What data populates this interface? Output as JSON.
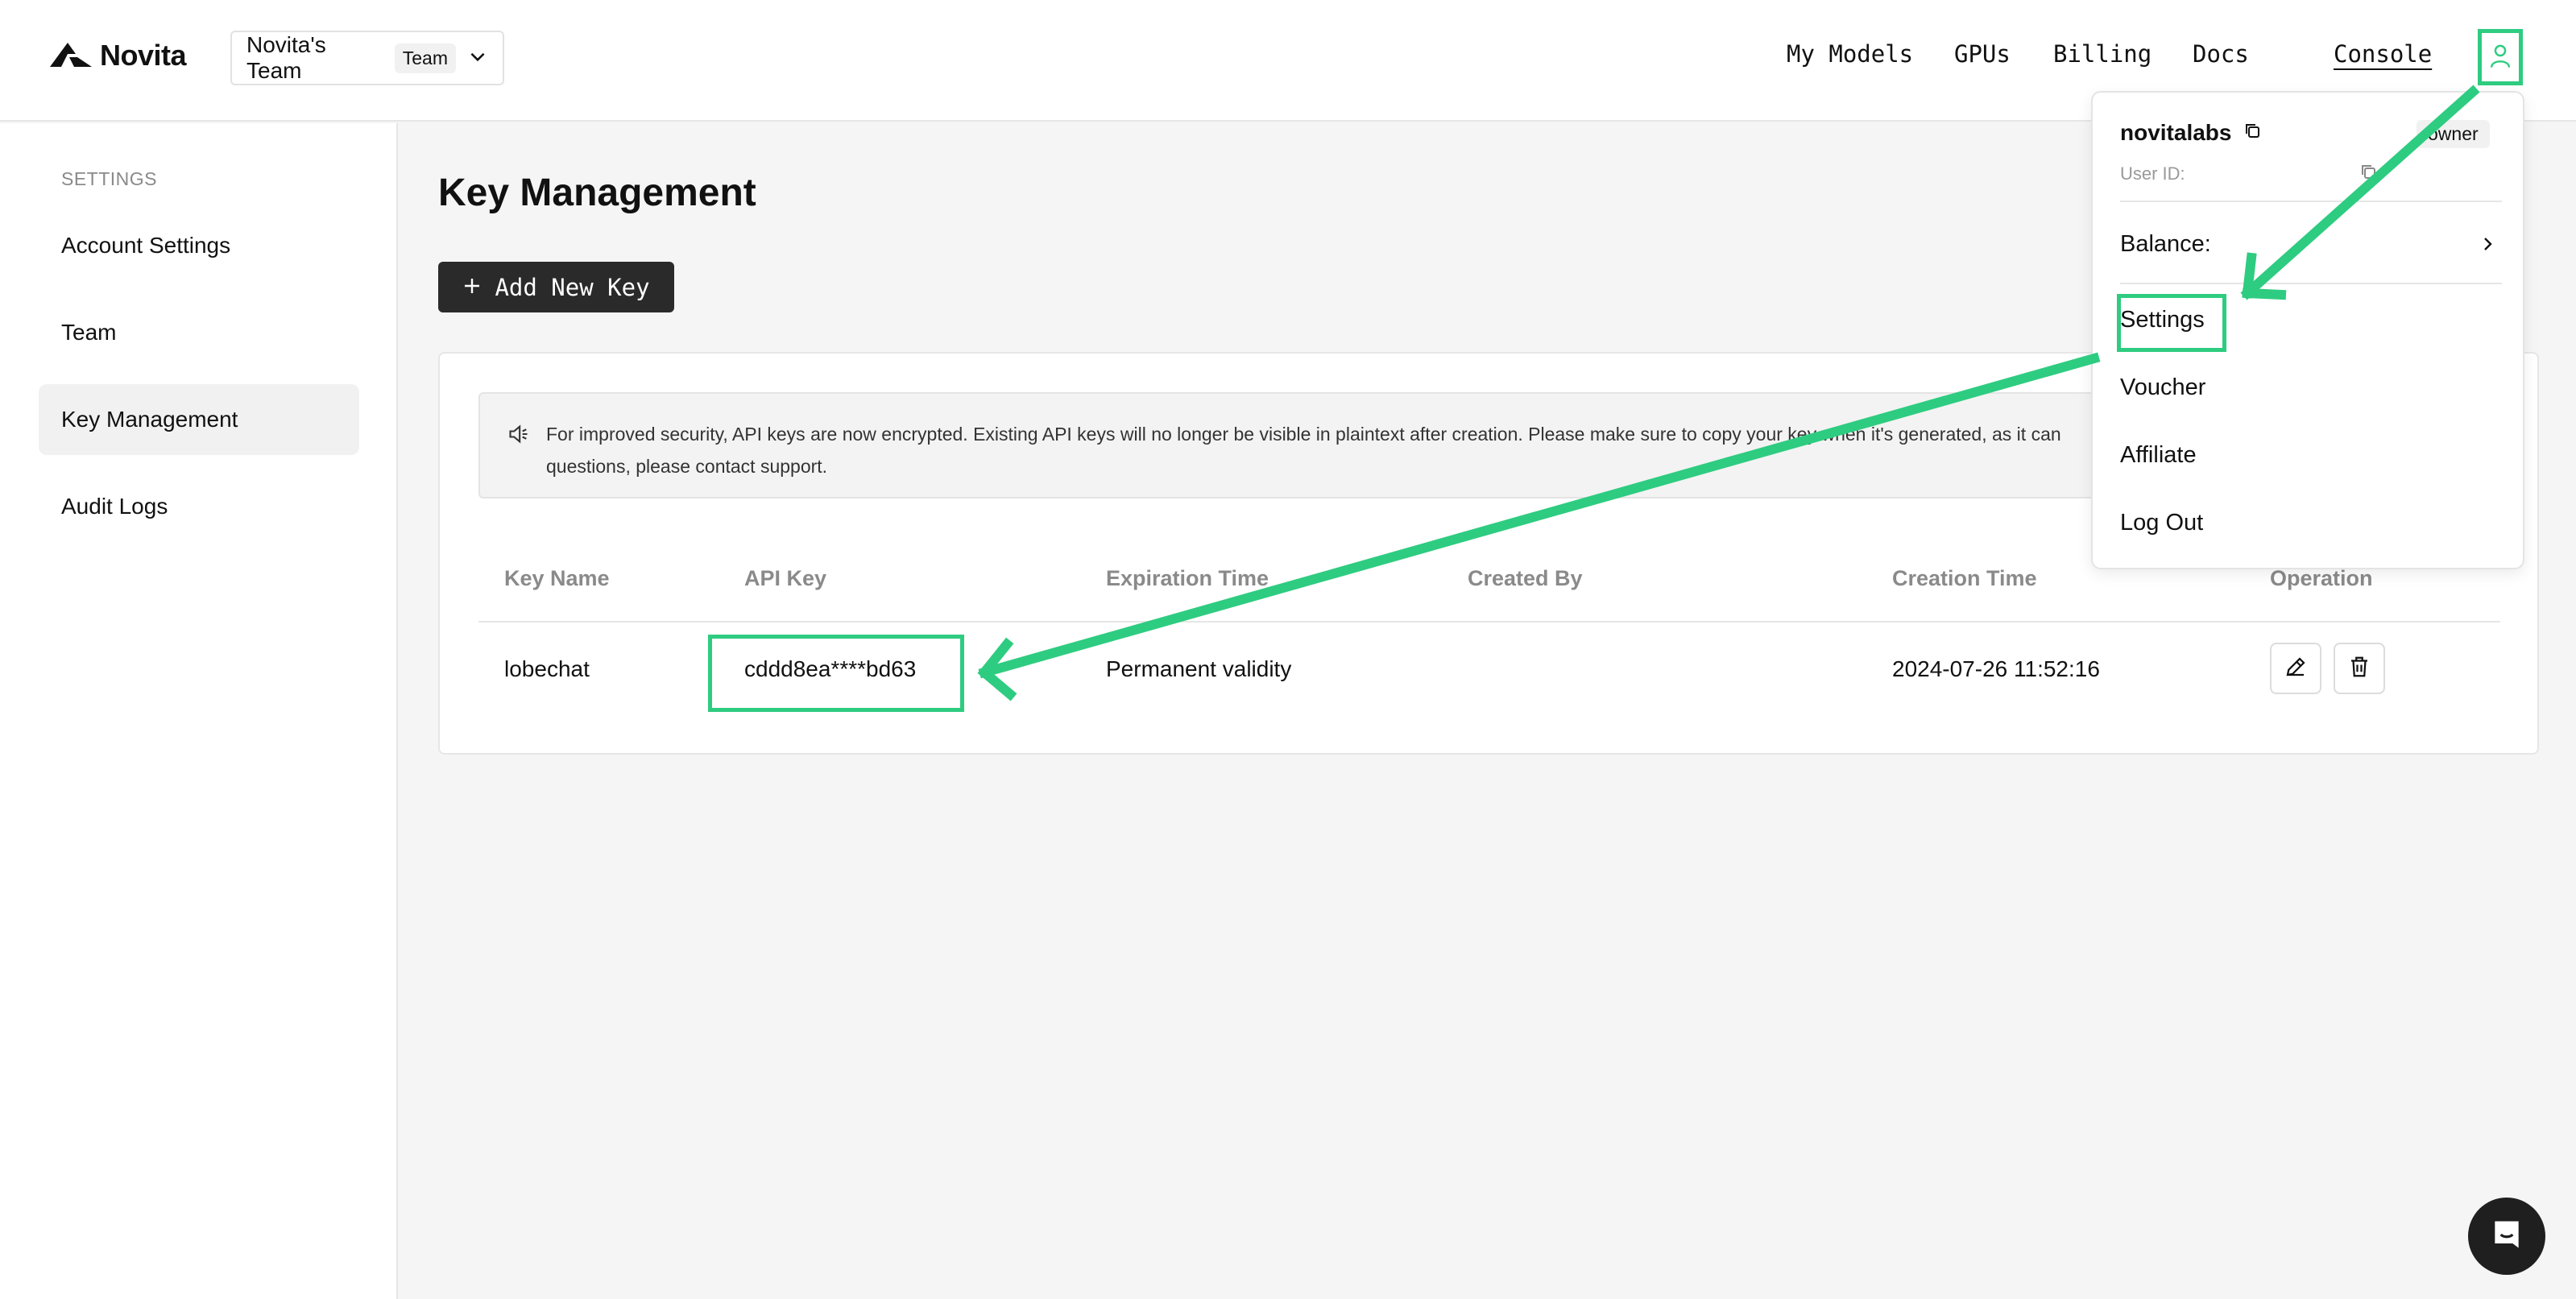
{
  "brand": {
    "name": "Novita"
  },
  "team_select": {
    "name": "Novita's Team",
    "badge": "Team"
  },
  "nav": {
    "items": [
      "My Models",
      "GPUs",
      "Billing",
      "Docs"
    ],
    "console": "Console"
  },
  "sidebar": {
    "section": "SETTINGS",
    "items": [
      {
        "label": "Account Settings"
      },
      {
        "label": "Team"
      },
      {
        "label": "Key Management",
        "active": true
      },
      {
        "label": "Audit Logs"
      }
    ]
  },
  "main": {
    "title": "Key Management",
    "add_button": "Add New Key",
    "notice_line1": "For improved security, API keys are now encrypted. Existing API keys will no longer be visible in plaintext after creation. Please make sure to copy your key when it's generated, as it can",
    "notice_line2": "questions, please contact support.",
    "table": {
      "headers": [
        "Key Name",
        "API Key",
        "Expiration Time",
        "Created By",
        "Creation Time",
        "Operation"
      ],
      "rows": [
        {
          "key_name": "lobechat",
          "api_key": "cddd8ea****bd63",
          "expiration": "Permanent validity",
          "created_by": "",
          "creation_time": "2024-07-26 11:52:16"
        }
      ]
    }
  },
  "user_menu": {
    "username": "novitalabs",
    "role": "owner",
    "user_id_label": "User ID:",
    "balance_label": "Balance:",
    "items": [
      "Settings",
      "Voucher",
      "Affiliate",
      "Log Out"
    ]
  },
  "colors": {
    "highlight": "#2ecc80",
    "primary_button": "#2a2a2a"
  },
  "icons": [
    "novita-logo-icon",
    "chevron-down-icon",
    "user-icon",
    "plus-icon",
    "speaker-icon",
    "copy-icon",
    "chevron-right-icon",
    "edit-icon",
    "trash-icon",
    "chat-icon"
  ]
}
